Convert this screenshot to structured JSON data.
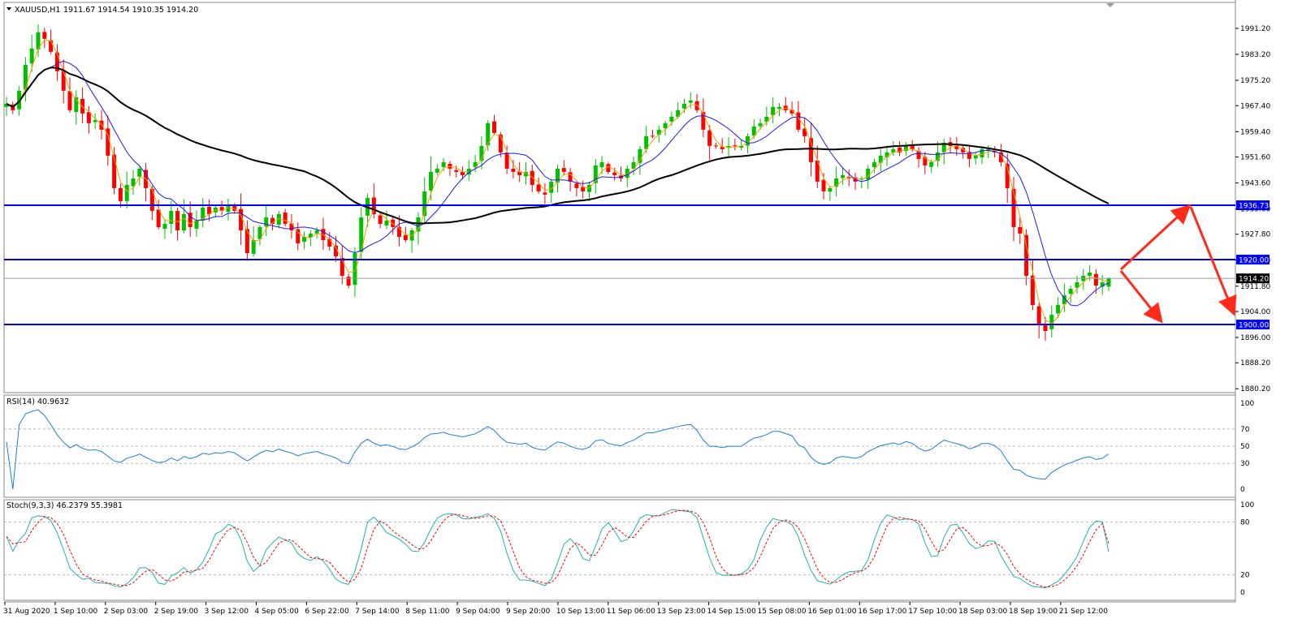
{
  "header": {
    "symbol": "XAUUSD,H1",
    "ohlc": "1911.67 1914.54 1910.35 1914.20"
  },
  "colors": {
    "bull": "#00c000",
    "bear": "#ff0000",
    "sma_long": "#000000",
    "sma_mid": "#1a1aff",
    "sma_short": "#f0a000",
    "level_line": "#0000ff",
    "rsi_line": "#1e7fd6",
    "stoch_main": "#20b2aa",
    "stoch_signal": "#ff0000",
    "arrow": "#ff2a1a"
  },
  "chart_data": [
    {
      "type": "candlestick",
      "panel": "price",
      "y_ticks": [
        "1991.20",
        "1983.20",
        "1975.20",
        "1967.40",
        "1959.40",
        "1951.60",
        "1943.60",
        "1935.60",
        "1927.80",
        "1919.80",
        "1911.80",
        "1904.00",
        "1896.00",
        "1888.20",
        "1880.20"
      ],
      "ylim": [
        1880.2,
        1995.0
      ],
      "x_labels": [
        "31 Aug 2020",
        "1 Sep 10:00",
        "2 Sep 03:00",
        "2 Sep 19:00",
        "3 Sep 12:00",
        "4 Sep 05:00",
        "6 Sep 22:00",
        "7 Sep 14:00",
        "8 Sep 11:00",
        "9 Sep 04:00",
        "9 Sep 20:00",
        "10 Sep 13:00",
        "11 Sep 06:00",
        "13 Sep 23:00",
        "14 Sep 15:00",
        "15 Sep 08:00",
        "16 Sep 01:00",
        "16 Sep 17:00",
        "17 Sep 10:00",
        "18 Sep 03:00",
        "18 Sep 19:00",
        "21 Sep 12:00"
      ],
      "close_path": [
        1968,
        1966,
        1972,
        1980,
        1985,
        1990,
        1988,
        1984,
        1978,
        1972,
        1966,
        1970,
        1965,
        1962,
        1963,
        1960,
        1952,
        1942,
        1938,
        1943,
        1945,
        1948,
        1942,
        1935,
        1930,
        1931,
        1935,
        1929,
        1934,
        1930,
        1932,
        1936,
        1934,
        1936,
        1935,
        1937,
        1935,
        1929,
        1922,
        1926,
        1930,
        1933,
        1931,
        1934,
        1931,
        1929,
        1925,
        1927,
        1928,
        1929,
        1926,
        1924,
        1921,
        1915,
        1912,
        1922,
        1933,
        1939,
        1934,
        1931,
        1932,
        1930,
        1927,
        1926,
        1929,
        1933,
        1941,
        1947,
        1948,
        1950,
        1948,
        1947,
        1946,
        1948,
        1950,
        1955,
        1962,
        1959,
        1953,
        1948,
        1947,
        1946,
        1947,
        1943,
        1941,
        1940,
        1944,
        1948,
        1947,
        1944,
        1942,
        1941,
        1943,
        1949,
        1950,
        1947,
        1946,
        1945,
        1948,
        1950,
        1954,
        1958,
        1958,
        1960,
        1962,
        1964,
        1966,
        1968,
        1969,
        1966,
        1960,
        1955,
        1955,
        1954,
        1955,
        1955,
        1955,
        1958,
        1961,
        1962,
        1964,
        1967,
        1967,
        1966,
        1965,
        1960,
        1958,
        1950,
        1944,
        1941,
        1942,
        1945,
        1946,
        1945,
        1944,
        1945,
        1948,
        1950,
        1952,
        1953,
        1954,
        1953,
        1955,
        1954,
        1951,
        1949,
        1950,
        1953,
        1956,
        1955,
        1954,
        1953,
        1951,
        1952,
        1954,
        1954,
        1953,
        1950,
        1942,
        1930,
        1928,
        1915,
        1906,
        1900,
        1898,
        1903,
        1906,
        1909,
        1911,
        1913,
        1915,
        1916,
        1912,
        1913,
        1914.2
      ],
      "series": [
        {
          "name": "",
          "values": []
        }
      ]
    },
    {
      "type": "line",
      "panel": "rsi",
      "label": "RSI(14) 40.9632",
      "y_ticks": [
        "100",
        "70",
        "50",
        "30",
        "0"
      ],
      "ylim": [
        0,
        100
      ],
      "levels": [
        70,
        50,
        30
      ],
      "last_value": 40.9632
    },
    {
      "type": "line",
      "panel": "stochastic",
      "label": "Stoch(9,3,3) 46.2379 55.3981",
      "y_ticks": [
        "100",
        "80",
        "20",
        "0"
      ],
      "ylim": [
        0,
        100
      ],
      "levels": [
        80,
        20
      ],
      "main_last": 46.2379,
      "signal_last": 55.3981
    }
  ],
  "levels": [
    {
      "value": 1936.73,
      "label": "1936.73"
    },
    {
      "value": 1920.0,
      "label": "1920.00"
    },
    {
      "value": 1900.0,
      "label": "1900.00"
    }
  ],
  "current_price": {
    "value": 1914.2,
    "label": "1914.20"
  },
  "scenario_arrows": [
    {
      "from": 1917.0,
      "to": 1936.73,
      "then": 1903.0
    },
    {
      "from": 1917.0,
      "to": 1900.0
    }
  ]
}
